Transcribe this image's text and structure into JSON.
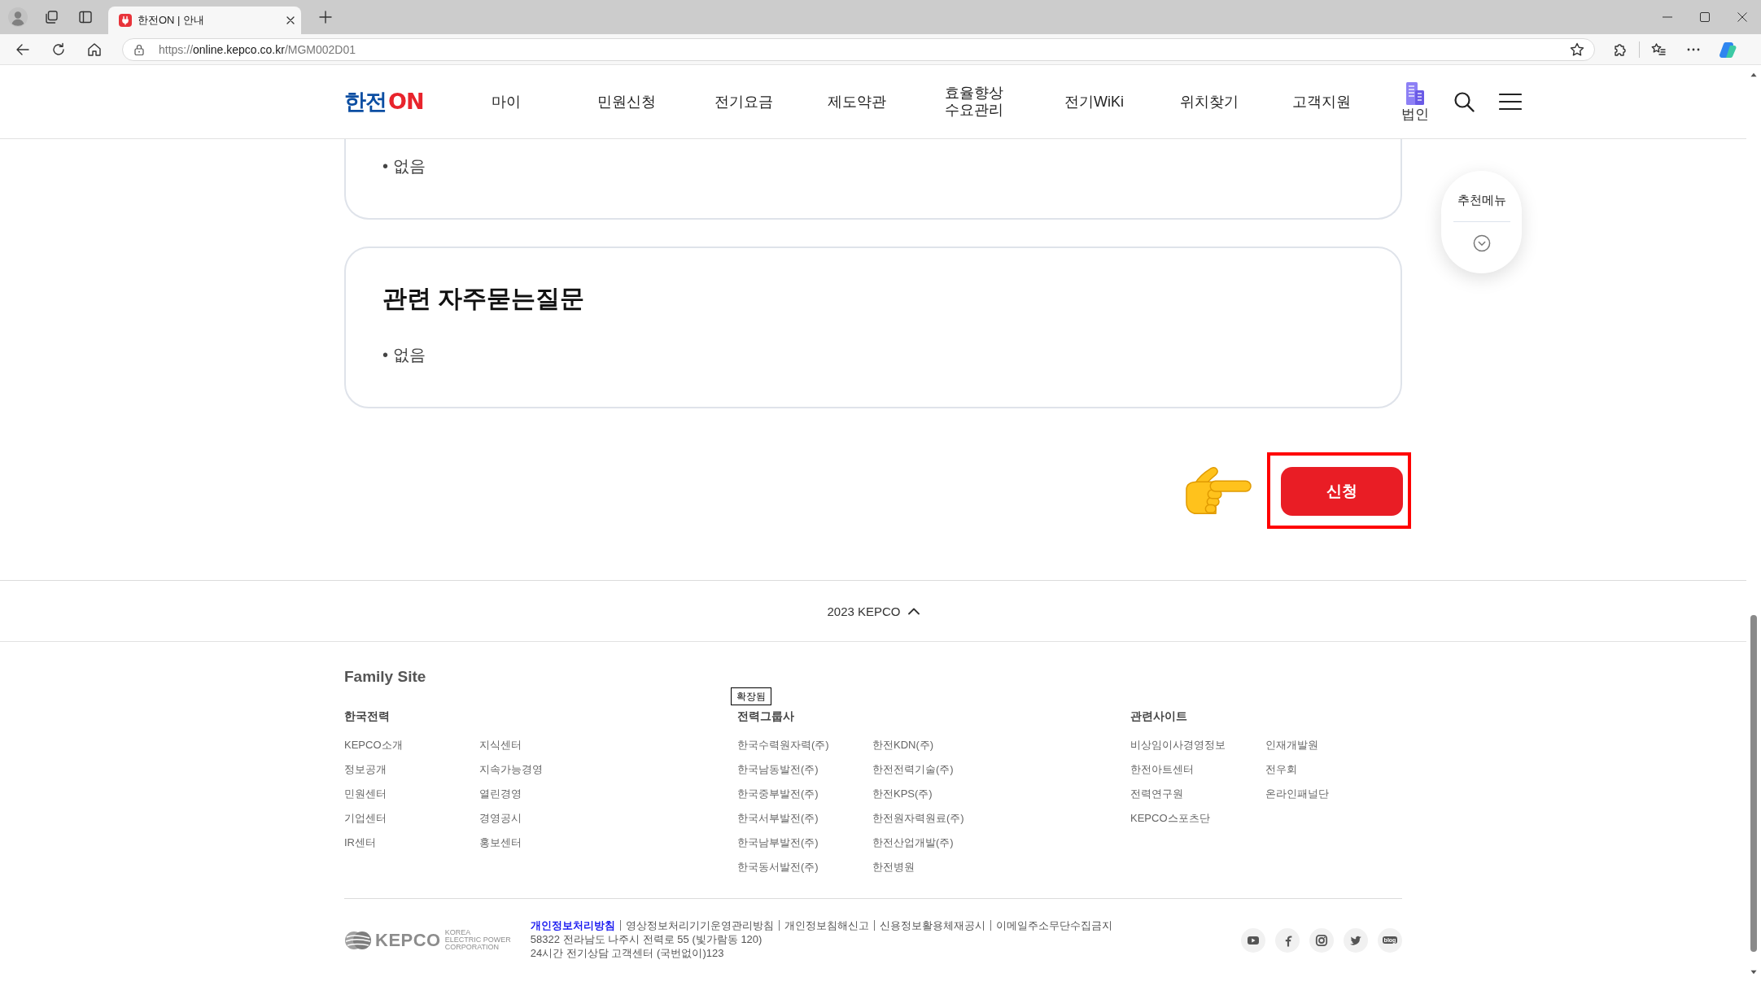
{
  "browser": {
    "tabs": [
      {
        "title": "한전ON | 안내",
        "selected": true
      }
    ],
    "url": {
      "scheme": "https://",
      "host": "online.kepco.co.kr",
      "path": "/MGM002D01"
    }
  },
  "header": {
    "logo": {
      "main": "한전",
      "accent": "ON"
    },
    "nav": [
      "마이",
      "민원신청",
      "전기요금",
      "제도약관",
      "효율향상\n수요관리",
      "전기WiKi",
      "위치찾기",
      "고객지원"
    ],
    "corporate": "법인"
  },
  "cards": [
    {
      "items": [
        "• 없음"
      ]
    },
    {
      "title": "관련 자주묻는질문",
      "items": [
        "• 없음"
      ]
    }
  ],
  "recommend_menu": {
    "label": "추천메뉴",
    "expanded": false
  },
  "apply": {
    "label": "신청",
    "highlighted": true
  },
  "footer": {
    "toggle": {
      "label": "2023 KEPCO",
      "expanded": true
    },
    "family_site": {
      "title": "Family Site",
      "tooltip": "확장됨",
      "groups": [
        {
          "title": "한국전력",
          "links": [
            "KEPCO소개",
            "지식센터",
            "정보공개",
            "지속가능경영",
            "민원센터",
            "열린경영",
            "기업센터",
            "경영공시",
            "IR센터",
            "홍보센터"
          ]
        },
        {
          "title": "전력그룹사",
          "links": [
            "한국수력원자력(주)",
            "한전KDN(주)",
            "한국남동발전(주)",
            "한전전력기술(주)",
            "한국중부발전(주)",
            "한전KPS(주)",
            "한국서부발전(주)",
            "한전원자력원료(주)",
            "한국남부발전(주)",
            "한전산업개발(주)",
            "한국동서발전(주)",
            "한전병원"
          ]
        },
        {
          "title": "관련사이트",
          "links": [
            "비상임이사경영정보",
            "인재개발원",
            "한전아트센터",
            "전우회",
            "전력연구원",
            "온라인패널단",
            "KEPCO스포츠단"
          ]
        }
      ]
    },
    "logo": {
      "wordmark": "KEPCO",
      "tagline": [
        "KOREA",
        "ELECTRIC POWER",
        "CORPORATION"
      ]
    },
    "policy_links": [
      {
        "label": "개인정보처리방침",
        "emphasis": true
      },
      {
        "label": "영상정보처리기기운영관리방침",
        "emphasis": false
      },
      {
        "label": "개인정보침해신고",
        "emphasis": false
      },
      {
        "label": "신용정보활용체재공시",
        "emphasis": false
      },
      {
        "label": "이메일주소무단수집금지",
        "emphasis": false
      }
    ],
    "address": "58322 전라남도 나주시 전력로 55 (빛가람동 120)",
    "call_center": "24시간 전기상담 고객센터 (국번없이)123",
    "social": [
      {
        "kind": "youtube"
      },
      {
        "kind": "facebook"
      },
      {
        "kind": "instagram"
      },
      {
        "kind": "twitter"
      },
      {
        "kind": "blog",
        "label": "blog"
      }
    ]
  }
}
